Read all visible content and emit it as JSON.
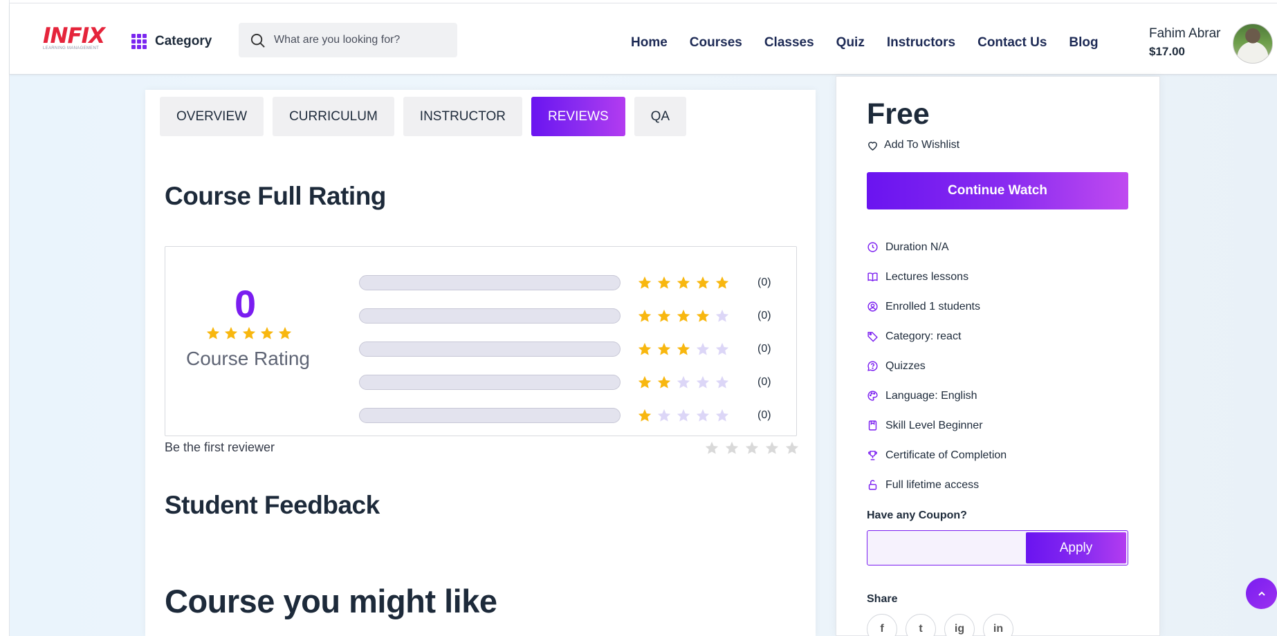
{
  "header": {
    "logo_text": "INFIX",
    "logo_subtitle": "LEARNING MANAGEMENT",
    "category_label": "Category",
    "search_placeholder": "What are you looking for?",
    "nav": [
      "Home",
      "Courses",
      "Classes",
      "Quiz",
      "Instructors",
      "Contact Us",
      "Blog"
    ],
    "user_name": "Fahim Abrar",
    "user_balance": "$17.00"
  },
  "tabs": [
    {
      "label": "OVERVIEW",
      "active": false
    },
    {
      "label": "CURRICULUM",
      "active": false
    },
    {
      "label": "INSTRUCTOR",
      "active": false
    },
    {
      "label": "REVIEWS",
      "active": true
    },
    {
      "label": "QA",
      "active": false
    }
  ],
  "rating": {
    "title": "Course Full Rating",
    "average": "0",
    "label": "Course Rating",
    "rows": [
      {
        "stars": 5,
        "count": "(0)",
        "fill": 0
      },
      {
        "stars": 4,
        "count": "(0)",
        "fill": 0
      },
      {
        "stars": 3,
        "count": "(0)",
        "fill": 0
      },
      {
        "stars": 2,
        "count": "(0)",
        "fill": 0
      },
      {
        "stars": 1,
        "count": "(0)",
        "fill": 0
      }
    ],
    "first_reviewer": "Be the first reviewer"
  },
  "feedback_title": "Student Feedback",
  "might_like_title": "Course you might like",
  "sidebar": {
    "price": "Free",
    "wishlist": "Add To Wishlist",
    "continue_label": "Continue Watch",
    "info": [
      {
        "icon": "clock-icon",
        "text": "Duration N/A"
      },
      {
        "icon": "book-icon",
        "text": "Lectures lessons"
      },
      {
        "icon": "user-icon",
        "text": "Enrolled 1 students"
      },
      {
        "icon": "tag-icon",
        "text": "Category: react"
      },
      {
        "icon": "question-icon",
        "text": "Quizzes"
      },
      {
        "icon": "palette-icon",
        "text": "Language: English"
      },
      {
        "icon": "badge-icon",
        "text": "Skill Level Beginner"
      },
      {
        "icon": "trophy-icon",
        "text": "Certificate of Completion"
      },
      {
        "icon": "lock-icon",
        "text": "Full lifetime access"
      }
    ],
    "coupon_label": "Have any Coupon?",
    "coupon_placeholder": "",
    "apply_label": "Apply",
    "share_label": "Share",
    "share_icons": [
      {
        "name": "facebook-icon",
        "glyph": "f"
      },
      {
        "name": "twitter-icon",
        "glyph": "t"
      },
      {
        "name": "instagram-icon",
        "glyph": "ig"
      },
      {
        "name": "linkedin-icon",
        "glyph": "in"
      }
    ]
  },
  "colors": {
    "accent": "#7a1df0",
    "star_filled": "#f8b70f",
    "star_empty_lavender": "#dcd6f7",
    "star_empty_gray": "#d9d9d9"
  }
}
